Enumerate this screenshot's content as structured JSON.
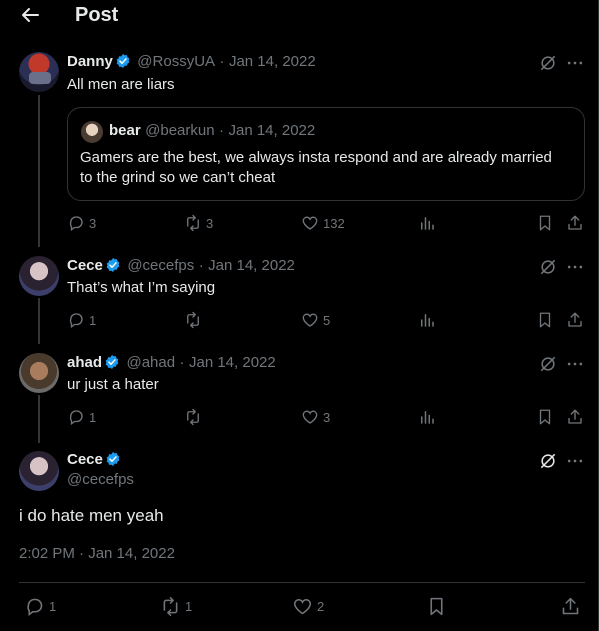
{
  "header": {
    "title": "Post"
  },
  "tweets": [
    {
      "name": "Danny",
      "handle": "@RossyUA",
      "sep": "·",
      "date": "Jan 14, 2022",
      "text": "All men are liars",
      "quote": {
        "name": "bear",
        "handle": "@bearkun",
        "sep": "·",
        "date": "Jan 14, 2022",
        "text_line1": "Gamers are the best, we always insta respond and are already married",
        "text_line2": "to the grind so we can’t cheat"
      },
      "replies": "3",
      "reposts": "3",
      "likes": "132"
    },
    {
      "name": "Cece",
      "handle": "@cecefps",
      "sep": "·",
      "date": "Jan 14, 2022",
      "text": "That’s what I’m saying",
      "replies": "1",
      "reposts": "",
      "likes": "5"
    },
    {
      "name": "ahad",
      "handle": "@ahad",
      "sep": "·",
      "date": "Jan 14, 2022",
      "text": "ur just a hater",
      "replies": "1",
      "reposts": "",
      "likes": "3"
    }
  ],
  "main": {
    "name": "Cece",
    "handle": "@cecefps",
    "text": "i do hate men yeah",
    "timestamp": "2:02 PM · Jan 14, 2022",
    "replies": "1",
    "reposts": "1",
    "likes": "2"
  },
  "colors": {
    "verified": "#1d9bf0",
    "muted": "#71767b",
    "border": "#2f3336"
  },
  "icons": [
    "back-arrow-icon",
    "grok-icon",
    "more-icon",
    "reply-icon",
    "repost-icon",
    "like-icon",
    "views-icon",
    "bookmark-icon",
    "share-icon",
    "verified-icon"
  ]
}
